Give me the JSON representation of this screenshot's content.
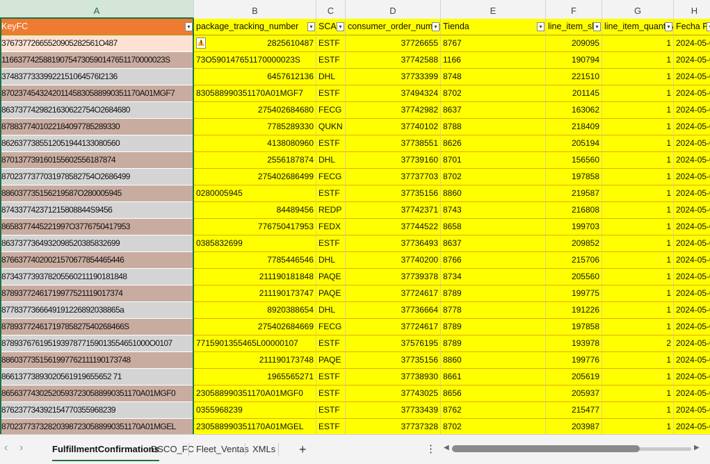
{
  "columns": [
    "A",
    "B",
    "C",
    "D",
    "E",
    "F",
    "G",
    "H"
  ],
  "header": {
    "a": "KeyFC",
    "b": "package_tracking_number",
    "c": "SCAC",
    "d": "consumer_order_number",
    "e": "Tienda",
    "f": "line_item_sku",
    "g": "line_item_quantity",
    "h": "Fecha FC"
  },
  "rows": [
    {
      "a": "37673772665520905282561O487",
      "b": "2825610487",
      "c": "ESTF",
      "d": "37726655",
      "e": "8767",
      "f": "209095",
      "g": "1",
      "h": "2024-05-04"
    },
    {
      "a": "116637742588190754730590147651170000023S",
      "b": "73O590147651170000023S",
      "c": "ESTF",
      "d": "37742588",
      "e": "1166",
      "f": "190794",
      "g": "1",
      "h": "2024-05-03"
    },
    {
      "a": "37483773339922151064576I2136",
      "b": "6457612136",
      "c": "DHL",
      "d": "37733399",
      "e": "8748",
      "f": "221510",
      "g": "1",
      "h": "2024-05-03"
    },
    {
      "a": "870237454324201145830588990351170A01MGF7",
      "b": "830588990351170A01MGF7",
      "c": "ESTF",
      "d": "37494324",
      "e": "8702",
      "f": "201145",
      "g": "1",
      "h": "2024-05-03"
    },
    {
      "a": "8637377429821630622754O2684680",
      "b": "275402684680",
      "c": "FECG",
      "d": "37742982",
      "e": "8637",
      "f": "163062",
      "g": "1",
      "h": "2024-05-03"
    },
    {
      "a": "8788377401022184097785289330",
      "b": "7785289330",
      "c": "QUKN",
      "d": "37740102",
      "e": "8788",
      "f": "218409",
      "g": "1",
      "h": "2024-05-03"
    },
    {
      "a": "8626377385512051944133080560",
      "b": "4138080960",
      "c": "ESTF",
      "d": "37738551",
      "e": "8626",
      "f": "205194",
      "g": "1",
      "h": "2024-05-03"
    },
    {
      "a": "870137739160155602556187874",
      "b": "2556187874",
      "c": "DHL",
      "d": "37739160",
      "e": "8701",
      "f": "156560",
      "g": "1",
      "h": "2024-05-03"
    },
    {
      "a": "8702377377031978582754O2686499",
      "b": "275402686499",
      "c": "FECG",
      "d": "37737703",
      "e": "8702",
      "f": "197858",
      "g": "1",
      "h": "2024-05-03"
    },
    {
      "a": "886037735156219587O280005945",
      "b": "0280005945",
      "c": "ESTF",
      "d": "37735156",
      "e": "8860",
      "f": "219587",
      "g": "1",
      "h": "2024-05-03"
    },
    {
      "a": "874337742371215808844S9456",
      "b": "84489456",
      "c": "REDP",
      "d": "37742371",
      "e": "8743",
      "f": "216808",
      "g": "1",
      "h": "2024-05-03"
    },
    {
      "a": "8658377445221997O3776750417953",
      "b": "776750417953",
      "c": "FEDX",
      "d": "37744522",
      "e": "8658",
      "f": "199703",
      "g": "1",
      "h": "2024-05-03"
    },
    {
      "a": "8637377364932098520385832699",
      "b": "0385832699",
      "c": "ESTF",
      "d": "37736493",
      "e": "8637",
      "f": "209852",
      "g": "1",
      "h": "2024-05-03"
    },
    {
      "a": "87663774020021570677854465446",
      "b": "7785446546",
      "c": "DHL",
      "d": "37740200",
      "e": "8766",
      "f": "215706",
      "g": "1",
      "h": "2024-05-03"
    },
    {
      "a": "873437739378205560211190181848",
      "b": "211190181848",
      "c": "PAQE",
      "d": "37739378",
      "e": "8734",
      "f": "205560",
      "g": "1",
      "h": "2024-05-03"
    },
    {
      "a": "87893772461719977521119017374",
      "b": "211190173747",
      "c": "PAQE",
      "d": "37724617",
      "e": "8789",
      "f": "199775",
      "g": "1",
      "h": "2024-05-03"
    },
    {
      "a": "8778377366649191226892038865a",
      "b": "8920388654",
      "c": "DHL",
      "d": "37736664",
      "e": "8778",
      "f": "191226",
      "g": "1",
      "h": "2024-05-03"
    },
    {
      "a": "87893772461719785827540268466S",
      "b": "275402684669",
      "c": "FECG",
      "d": "37724617",
      "e": "8789",
      "f": "197858",
      "g": "1",
      "h": "2024-05-03"
    },
    {
      "a": "87893767619519397877159013554651000O0107",
      "b": "7715901355465L00000107",
      "c": "ESTF",
      "d": "37576195",
      "e": "8789",
      "f": "193978",
      "g": "2",
      "h": "2024-05-03"
    },
    {
      "a": "8860377351561997762111190173748",
      "b": "211190173748",
      "c": "PAQE",
      "d": "37735156",
      "e": "8860",
      "f": "199776",
      "g": "1",
      "h": "2024-05-03"
    },
    {
      "a": "86613773893020561919655652 71",
      "b": "1965565271",
      "c": "ESTF",
      "d": "37738930",
      "e": "8661",
      "f": "205619",
      "g": "1",
      "h": "2024-05-03"
    },
    {
      "a": "865637743025205937230588990351170A01MGF0",
      "b": "230588990351170A01MGF0",
      "c": "ESTF",
      "d": "37743025",
      "e": "8656",
      "f": "205937",
      "g": "1",
      "h": "2024-05-03"
    },
    {
      "a": "876237734392154770355968239",
      "b": "0355968239",
      "c": "ESTF",
      "d": "37733439",
      "e": "8762",
      "f": "215477",
      "g": "1",
      "h": "2024-05-03"
    },
    {
      "a": "870237737328203987230588990351170A01MGEL",
      "b": "230588990351170A01MGEL",
      "c": "ESTF",
      "d": "37737328",
      "e": "8702",
      "f": "203987",
      "g": "1",
      "h": "2024-05-03"
    }
  ],
  "tabs": [
    {
      "label": "FulfillmentConfirmations"
    },
    {
      "label": "DSCO_FC"
    },
    {
      "label": "Fleet_Ventas"
    },
    {
      "label": "XMLs"
    }
  ],
  "add_tab": "+",
  "nav_prev": "‹",
  "nav_next": "›",
  "more": "⋮",
  "colors": {
    "accent": "#1e7145",
    "header_a": "#ee7b32",
    "yellow": "#ffff00"
  }
}
